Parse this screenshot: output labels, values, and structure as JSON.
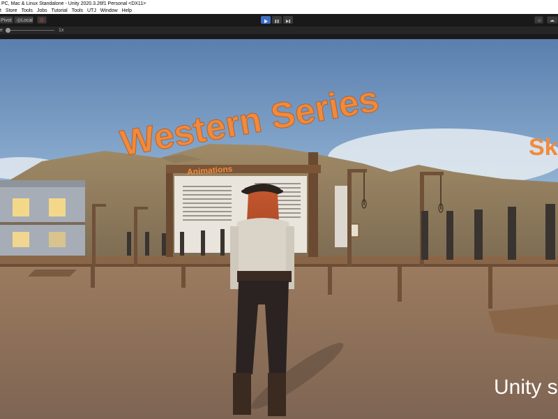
{
  "window": {
    "title": "PC, Mac & Linux Standalone - Unity 2020.3.26f1 Personal <DX11>"
  },
  "menu": {
    "items": [
      "t",
      "Store",
      "Tools",
      "Jobs",
      "Tutorial",
      "Tools",
      "UTJ",
      "Window",
      "Help"
    ]
  },
  "toolbar": {
    "pivot_label": "Pivot",
    "local_label": "Local"
  },
  "scene_bar": {
    "scale_prefix": "e",
    "scale_value": "1x"
  },
  "scene": {
    "title_text": "Western Series",
    "skin_text": "Ski",
    "sign_label": "Animations",
    "watermark": "Unity s"
  },
  "colors": {
    "play_active": "#3d6fc2",
    "title_orange": "#f08a3c"
  }
}
